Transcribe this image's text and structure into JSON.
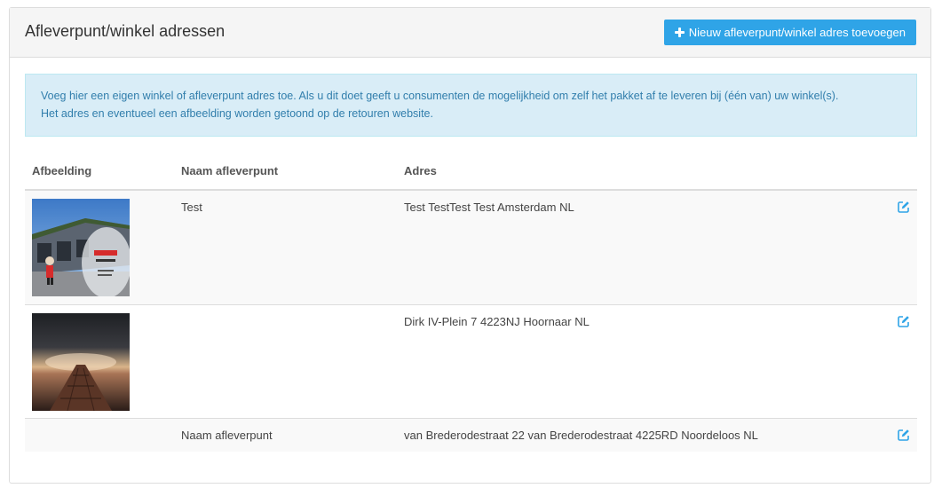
{
  "header": {
    "title": "Afleverpunt/winkel adressen",
    "add_button_label": "Nieuw afleverpunt/winkel adres toevoegen"
  },
  "alert": {
    "line1": "Voeg hier een eigen winkel of afleverpunt adres toe. Als u dit doet geeft u consumenten de mogelijkheid om zelf het pakket af te leveren bij (één van) uw winkel(s).",
    "line2": "Het adres en eventueel een afbeelding worden getoond op de retouren website."
  },
  "table": {
    "columns": [
      "Afbeelding",
      "Naam afleverpunt",
      "Adres"
    ],
    "rows": [
      {
        "name": "Test",
        "address": "Test TestTest Test Amsterdam NL"
      },
      {
        "name": "",
        "address": "Dirk IV-Plein 7 4223NJ Hoornaar NL"
      },
      {
        "name": "Naam afleverpunt",
        "address": "van Brederodestraat 22 van Brederodestraat 4225RD Noordeloos NL"
      }
    ]
  },
  "colors": {
    "primary": "#2fa4e7",
    "alert_bg": "#d9edf7",
    "alert_text": "#317eac"
  }
}
